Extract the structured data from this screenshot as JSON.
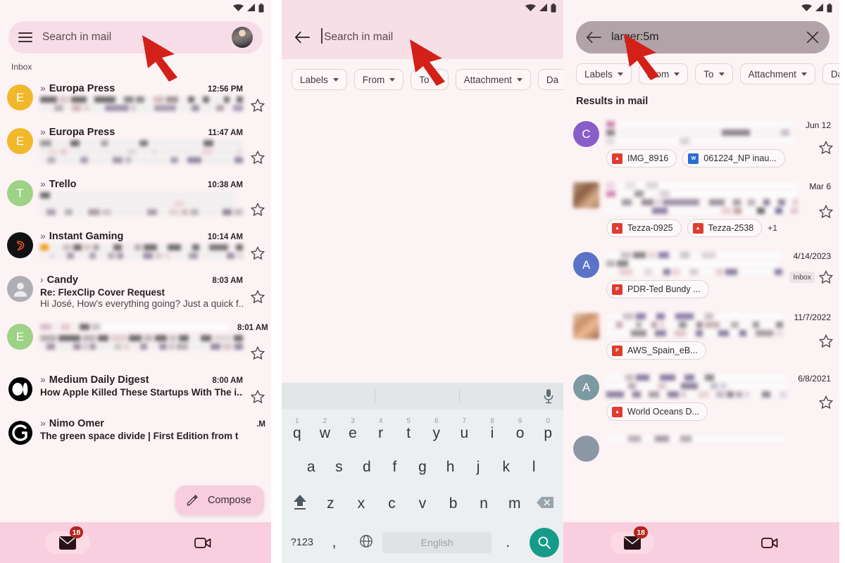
{
  "statusbar": {
    "icons": [
      "wifi-icon",
      "signal-icon",
      "battery-icon"
    ]
  },
  "panel1": {
    "search": {
      "placeholder": "Search in mail",
      "menu_icon": "hamburger-menu-icon",
      "avatar": "profile-avatar"
    },
    "section_label": "Inbox",
    "emails": [
      {
        "sender": "Europa Press",
        "time": "12:56 PM",
        "avatar_letter": "E",
        "avatar_color": "#f2b82b",
        "avatar_type": "letter",
        "unread": true,
        "redacted": true
      },
      {
        "sender": "Europa Press",
        "time": "11:47 AM",
        "avatar_letter": "E",
        "avatar_color": "#f2b82b",
        "avatar_type": "letter",
        "unread": true,
        "redacted": true
      },
      {
        "sender": "Trello",
        "time": "10:38 AM",
        "avatar_letter": "T",
        "avatar_color": "#9ed286",
        "avatar_type": "letter",
        "unread": true,
        "redacted": true
      },
      {
        "sender": "Instant Gaming",
        "time": "10:14 AM",
        "avatar_letter": "",
        "avatar_color": "#121212",
        "avatar_type": "logo-instant-gaming",
        "unread": true,
        "redacted": true
      },
      {
        "sender": "Candy",
        "time": "8:03 AM",
        "avatar_letter": "",
        "avatar_color": "#b0aeb4",
        "avatar_type": "person",
        "unread": false,
        "redacted": false,
        "subject": "Re: FlexClip Cover Request",
        "snippet": "Hi José, How's everything going? Just a quick f..."
      },
      {
        "sender": "",
        "time": "8:01 AM",
        "avatar_letter": "E",
        "avatar_color": "#9ed286",
        "avatar_type": "letter",
        "unread": false,
        "redacted": true,
        "sender_redacted": true
      },
      {
        "sender": "Medium Daily Digest",
        "time": "8:00 AM",
        "avatar_letter": "",
        "avatar_color": "#000000",
        "avatar_type": "logo-medium",
        "unread": true,
        "redacted": false,
        "subject": "How Apple Killed These Startups With The i..."
      },
      {
        "sender": "Nimo Omer",
        "time": ".M",
        "avatar_letter": "",
        "avatar_color": "#000000",
        "avatar_type": "logo-guardian",
        "unread": true,
        "redacted": false,
        "subject": "The green space divide | First Edition from t"
      }
    ],
    "compose": {
      "label": "Compose",
      "icon": "pencil-icon"
    },
    "bottomnav": {
      "mail_icon": "mail-icon",
      "mail_badge": "18",
      "meet_icon": "video-camera-icon"
    }
  },
  "panel2": {
    "search": {
      "back_icon": "back-arrow-icon",
      "placeholder": "Search in mail",
      "value": ""
    },
    "chips": [
      {
        "label": "Labels"
      },
      {
        "label": "From"
      },
      {
        "label": "To"
      },
      {
        "label": "Attachment"
      },
      {
        "label": "Da"
      }
    ],
    "keyboard": {
      "mic_icon": "microphone-icon",
      "row1": [
        {
          "letter": "q",
          "num": "1"
        },
        {
          "letter": "w",
          "num": "2"
        },
        {
          "letter": "e",
          "num": "3"
        },
        {
          "letter": "r",
          "num": "4"
        },
        {
          "letter": "t",
          "num": "5"
        },
        {
          "letter": "y",
          "num": "6"
        },
        {
          "letter": "u",
          "num": "7"
        },
        {
          "letter": "i",
          "num": "8"
        },
        {
          "letter": "o",
          "num": "9"
        },
        {
          "letter": "p",
          "num": "0"
        }
      ],
      "row2": [
        "a",
        "s",
        "d",
        "f",
        "g",
        "h",
        "j",
        "k",
        "l"
      ],
      "row3": [
        "z",
        "x",
        "c",
        "v",
        "b",
        "n",
        "m"
      ],
      "shift_icon": "shift-icon",
      "backspace_icon": "backspace-icon",
      "symbols_label": "?123",
      "comma_label": ",",
      "globe_icon": "globe-icon",
      "spacebar_label": "English",
      "period_label": ".",
      "search_icon": "search-icon"
    }
  },
  "panel3": {
    "search": {
      "back_icon": "back-arrow-icon",
      "value": "larger:5m",
      "clear_icon": "close-icon"
    },
    "chips": [
      {
        "label": "Labels"
      },
      {
        "label": "From"
      },
      {
        "label": "To"
      },
      {
        "label": "Attachment"
      },
      {
        "label": "Da"
      }
    ],
    "results_label": "Results in mail",
    "results": [
      {
        "time": "Jun 12",
        "avatar_letter": "C",
        "avatar_color": "#8a5ec9",
        "avatar_type": "letter",
        "attachments": [
          {
            "name": "IMG_8916",
            "type": "image"
          },
          {
            "name": "061224_NP inau...",
            "type": "doc"
          }
        ],
        "more": ""
      },
      {
        "time": "Mar 6",
        "avatar_letter": "",
        "avatar_color": "#a98d78",
        "avatar_type": "photo",
        "attachments": [
          {
            "name": "Tezza-0925",
            "type": "image"
          },
          {
            "name": "Tezza-2538",
            "type": "image"
          }
        ],
        "more": "+1"
      },
      {
        "time": "4/14/2023",
        "avatar_letter": "A",
        "avatar_color": "#5b72c9",
        "avatar_type": "letter",
        "label_badge": "Inbox",
        "attachments": [
          {
            "name": "PDR-Ted Bundy ...",
            "type": "pdf"
          }
        ],
        "more": ""
      },
      {
        "time": "11/7/2022",
        "avatar_letter": "",
        "avatar_color": "#c79a82",
        "avatar_type": "photo",
        "attachments": [
          {
            "name": "AWS_Spain_eB...",
            "type": "pdf"
          }
        ],
        "more": ""
      },
      {
        "time": "6/8/2021",
        "avatar_letter": "A",
        "avatar_color": "#7d9aa2",
        "avatar_type": "letter",
        "attachments": [
          {
            "name": "World Oceans D...",
            "type": "image"
          }
        ],
        "more": ""
      }
    ],
    "bottomnav": {
      "mail_icon": "mail-icon",
      "mail_badge": "18",
      "meet_icon": "video-camera-icon"
    }
  },
  "annotations": {
    "arrows": [
      "red-arrow-pointer-1",
      "red-arrow-pointer-2",
      "red-arrow-pointer-3"
    ],
    "arrow_color": "#d32018"
  }
}
